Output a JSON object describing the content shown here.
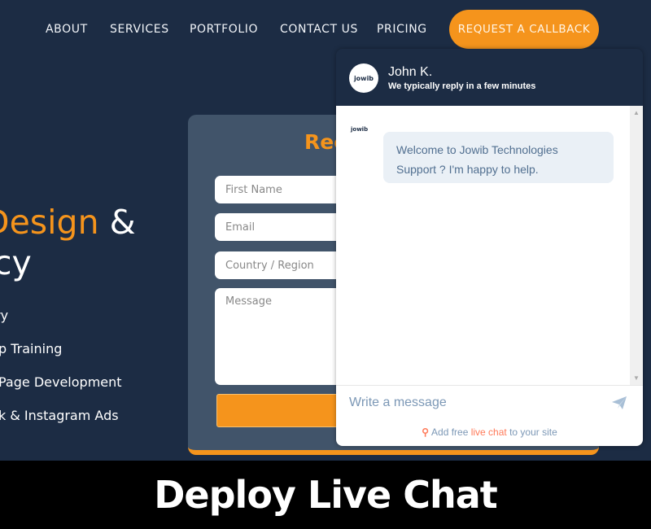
{
  "nav": {
    "items": [
      {
        "label": "ABOUT"
      },
      {
        "label": "SERVICES"
      },
      {
        "label": "PORTFOLIO"
      },
      {
        "label": "CONTACT US"
      },
      {
        "label": "PRICING"
      }
    ],
    "cta_label": "REQUEST A CALLBACK"
  },
  "hero": {
    "title_accent": "Design",
    "title_amp": "&",
    "title_line2": "cy",
    "bullets": [
      "ry",
      "p Training",
      "Page Development",
      "k & Instagram Ads"
    ]
  },
  "form": {
    "title": "Rec",
    "fields": {
      "first_name_placeholder": "First Name",
      "email_placeholder": "Email",
      "country_placeholder": "Country / Region",
      "message_placeholder": "Message"
    }
  },
  "chat": {
    "agent_name": "John K.",
    "status": "We typically reply in a few minutes",
    "avatar_text": "jowib",
    "messages": [
      {
        "from": "agent",
        "text": "Welcome to Jowib Technologies Support ? I'm happy to help."
      }
    ],
    "input_placeholder": "Write a message",
    "branding_prefix": "Add free ",
    "branding_link": "live chat",
    "branding_suffix": " to your site"
  },
  "caption": "Deploy Live Chat",
  "colors": {
    "background": "#1c2c44",
    "accent": "#f5941c",
    "form_card": "#41546a",
    "bubble": "#eaf0f6",
    "hubspot": "#ff7a59"
  }
}
